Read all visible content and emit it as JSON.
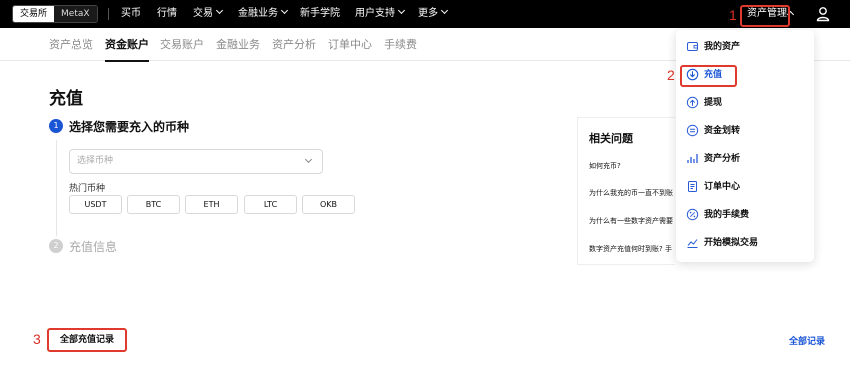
{
  "topbar": {
    "segment": {
      "exchange": "交易所",
      "metax": "MetaX"
    },
    "nav": {
      "buy": "买币",
      "market": "行情",
      "trade": "交易",
      "finance": "金融业务",
      "academy": "新手学院",
      "support": "用户支持",
      "more": "更多",
      "assets": "资产管理"
    }
  },
  "subnav": [
    "资产总览",
    "资金账户",
    "交易账户",
    "金融业务",
    "资产分析",
    "订单中心",
    "手续费"
  ],
  "page": {
    "title": "充值",
    "step1": {
      "num": "1",
      "label": "选择您需要充入的币种"
    },
    "select_placeholder": "选择币种",
    "hot_label": "热门币种",
    "coins": [
      "USDT",
      "BTC",
      "ETH",
      "LTC",
      "OKB"
    ],
    "step2": {
      "num": "2",
      "label": "充值信息"
    }
  },
  "faq": {
    "title": "相关问题",
    "questions": [
      "如何充币?",
      "为什么我充的币一直不到账",
      "为什么有一些数字资产需要",
      "数字资产充值何时到账? 手"
    ]
  },
  "dropdown": {
    "items": [
      "我的资产",
      "充值",
      "提现",
      "资金划转",
      "资产分析",
      "订单中心",
      "我的手续费",
      "开始模拟交易"
    ]
  },
  "footer": {
    "all_deposit_records": "全部充值记录",
    "all_records": "全部记录"
  },
  "annotations": [
    "1",
    "2",
    "3"
  ],
  "colors": {
    "accent_blue": "#1a55d6",
    "annotation_red": "#e03a2f",
    "topbar": "#000000"
  }
}
